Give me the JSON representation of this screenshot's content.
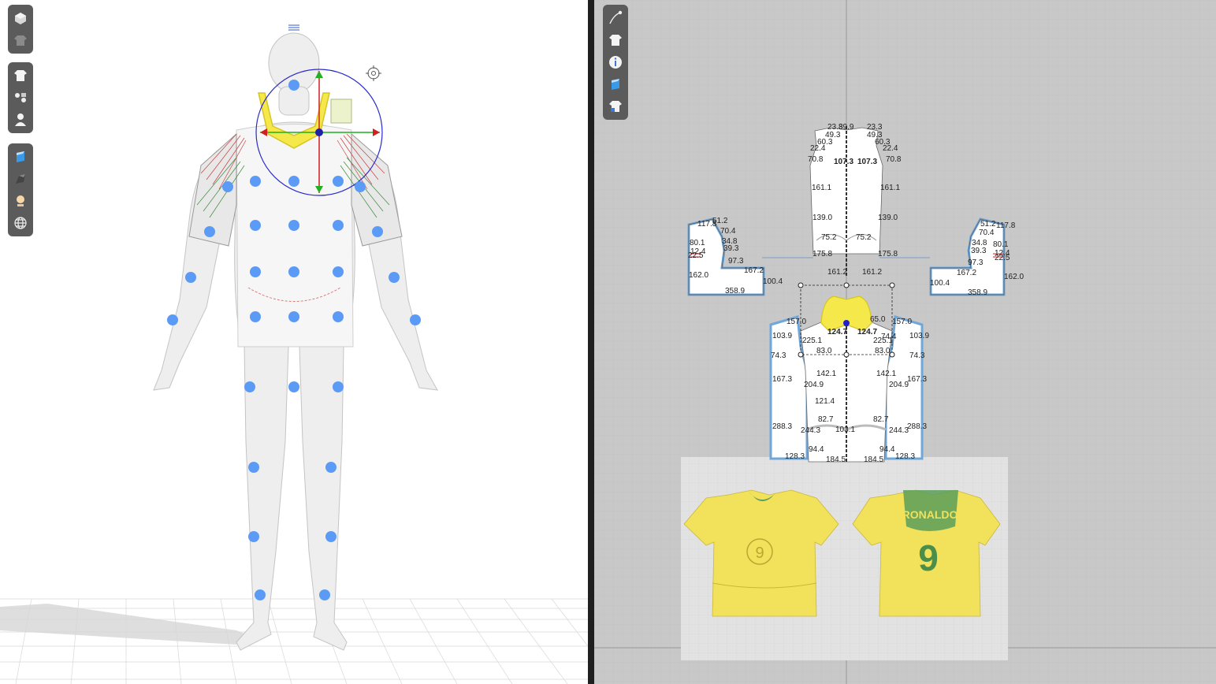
{
  "viewport_3d": {
    "toolbar_groups": [
      [
        "display-avatar-icon",
        "display-garment-icon"
      ],
      [
        "garment-shirt-icon",
        "avatar-arrangement-icon",
        "avatar-icon"
      ],
      [
        "texture-icon",
        "surface-icon",
        "light-icon",
        "globe-icon"
      ]
    ]
  },
  "viewport_2d": {
    "toolbar": [
      "pen-tool-icon",
      "shirt-icon",
      "info-icon",
      "texture-icon",
      "garment-home-icon"
    ],
    "measurements": {
      "torso_back_top": [
        "23.3",
        "49.3",
        "89.9",
        "60.3",
        "22.4",
        "70.8",
        "107.3",
        "161.1",
        "139.0",
        "175.8",
        "161.2",
        "75.2"
      ],
      "sleeve_left": [
        "51.2",
        "117.8",
        "70.4",
        "34.8",
        "80.1",
        "12.4",
        "22.5",
        "39.3",
        "97.3",
        "167.2",
        "162.0",
        "100.4",
        "358.9"
      ],
      "sleeve_right": [
        "51.2",
        "117.8",
        "70.4",
        "34.8",
        "80.1",
        "12.4",
        "22.5",
        "39.3",
        "97.3",
        "167.2",
        "162.0",
        "100.4",
        "358.9"
      ],
      "front_panel": [
        "157.0",
        "103.9",
        "74.3",
        "167.3",
        "288.3",
        "128.3",
        "225.1",
        "83.0",
        "142.1",
        "204.9",
        "121.4",
        "82.7",
        "244.3",
        "94.4",
        "184.5",
        "103.1",
        "65.0",
        "74.4",
        "124.7"
      ]
    },
    "reference_image": {
      "back_name": "RONALDO",
      "number": "9"
    }
  },
  "colors": {
    "pattern_outline": "#6fa7d9",
    "grid_bg": "#c8c8c8",
    "jersey_yellow": "#f2e15a",
    "jersey_green": "#5a9e5a",
    "pin_blue": "#5b9bf5"
  }
}
